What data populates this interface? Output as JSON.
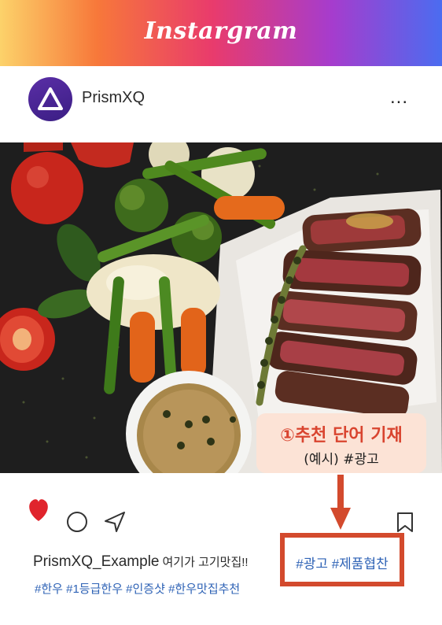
{
  "header": {
    "title": "Instargram"
  },
  "profile": {
    "username": "PrismXQ",
    "more_label": "..."
  },
  "photo": {
    "subject": "steak-with-vegetables"
  },
  "callout": {
    "line1": "①추천 단어 기재",
    "line2": "(예시) #광고"
  },
  "actions": {
    "like_icon": "heart-icon",
    "comment_icon": "comment-icon",
    "share_icon": "send-icon",
    "save_icon": "bookmark-icon",
    "liked_color": "#e0242c"
  },
  "caption": {
    "username": "PrismXQ_Example",
    "text": "여기가 고기맛집!!"
  },
  "hashtags": "#한우 #1등급한우 #인증샷 #한우맛집추천",
  "ad_tags": "#광고 #제품협찬",
  "colors": {
    "accent_red": "#d34a2d",
    "hashtag_blue": "#2f63b6",
    "callout_bg": "#fce3d6"
  }
}
